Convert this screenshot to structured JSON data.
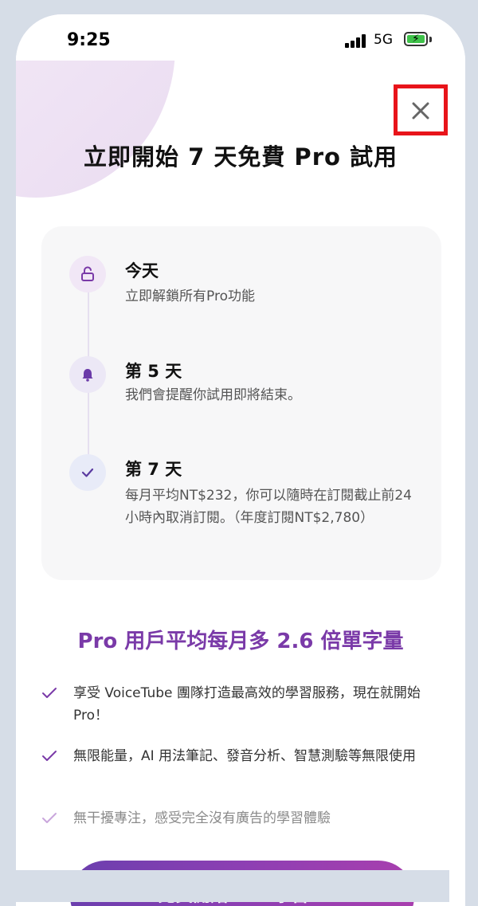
{
  "status_bar": {
    "time": "9:25",
    "network": "5G"
  },
  "header": {
    "title": "立即開始 7 天免費 Pro 試用"
  },
  "timeline": [
    {
      "icon": "lock-open-icon",
      "title": "今天",
      "description": "立即解鎖所有Pro功能"
    },
    {
      "icon": "bell-icon",
      "title": "第 5 天",
      "description": "我們會提醒你試用即將結束。"
    },
    {
      "icon": "check-icon",
      "title": "第 7 天",
      "description": "每月平均NT$232，你可以隨時在訂閱截止前24小時內取消訂閱。（年度訂閱NT$2,780）"
    }
  ],
  "subheading": "Pro 用戶平均每月多 2.6 倍單字量",
  "benefits": [
    "享受 VoiceTube 團隊打造最高效的學習服務，現在就開始 Pro！",
    "無限能量，AI 用法筆記、發音分析、智慧測驗等無限使用",
    "無干擾專注，感受完全沒有廣告的學習體驗"
  ],
  "cta": {
    "label": "免費開始 Pro 學習！"
  },
  "colors": {
    "accent": "#7a3aa8",
    "highlight_box": "#e8141a",
    "cta_start": "#6b3fae",
    "cta_end": "#a83fae",
    "battery": "#3fc24a"
  }
}
